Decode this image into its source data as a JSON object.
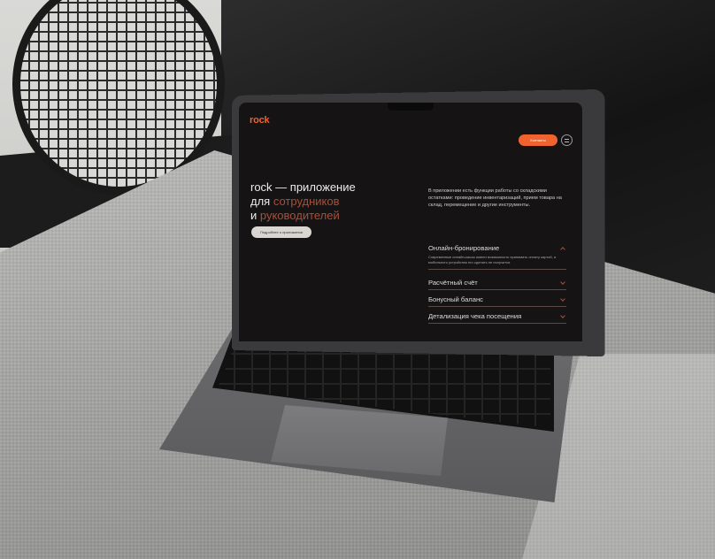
{
  "site": {
    "logo": "rock",
    "contacts_button": "Контакты",
    "hero": {
      "title_line1": "rock — приложение",
      "title_line2_prefix": "для ",
      "title_line2_accent": "сотрудников",
      "title_line3_prefix": "и ",
      "title_line3_accent": "руководителей",
      "more_button": "Подробнее о приложении"
    },
    "description": "В приложении есть функции работы со складскими остатками: проведение инвентаризаций, прием товара на склад, перемещение и другие инструменты.",
    "accordion": [
      {
        "title": "Онлайн-бронирование",
        "body": "Современные онлайн-кассы имеют возможность принимать оплату картой, а мобильного устройства это сделать не получится.",
        "expanded": true
      },
      {
        "title": "Расчётный счёт",
        "expanded": false
      },
      {
        "title": "Бонусный баланс",
        "expanded": false
      },
      {
        "title": "Детализация чека посещения",
        "expanded": false
      }
    ]
  },
  "colors": {
    "accent": "#f0622e",
    "muted_accent": "#a8503a",
    "screen_bg": "#151313"
  }
}
